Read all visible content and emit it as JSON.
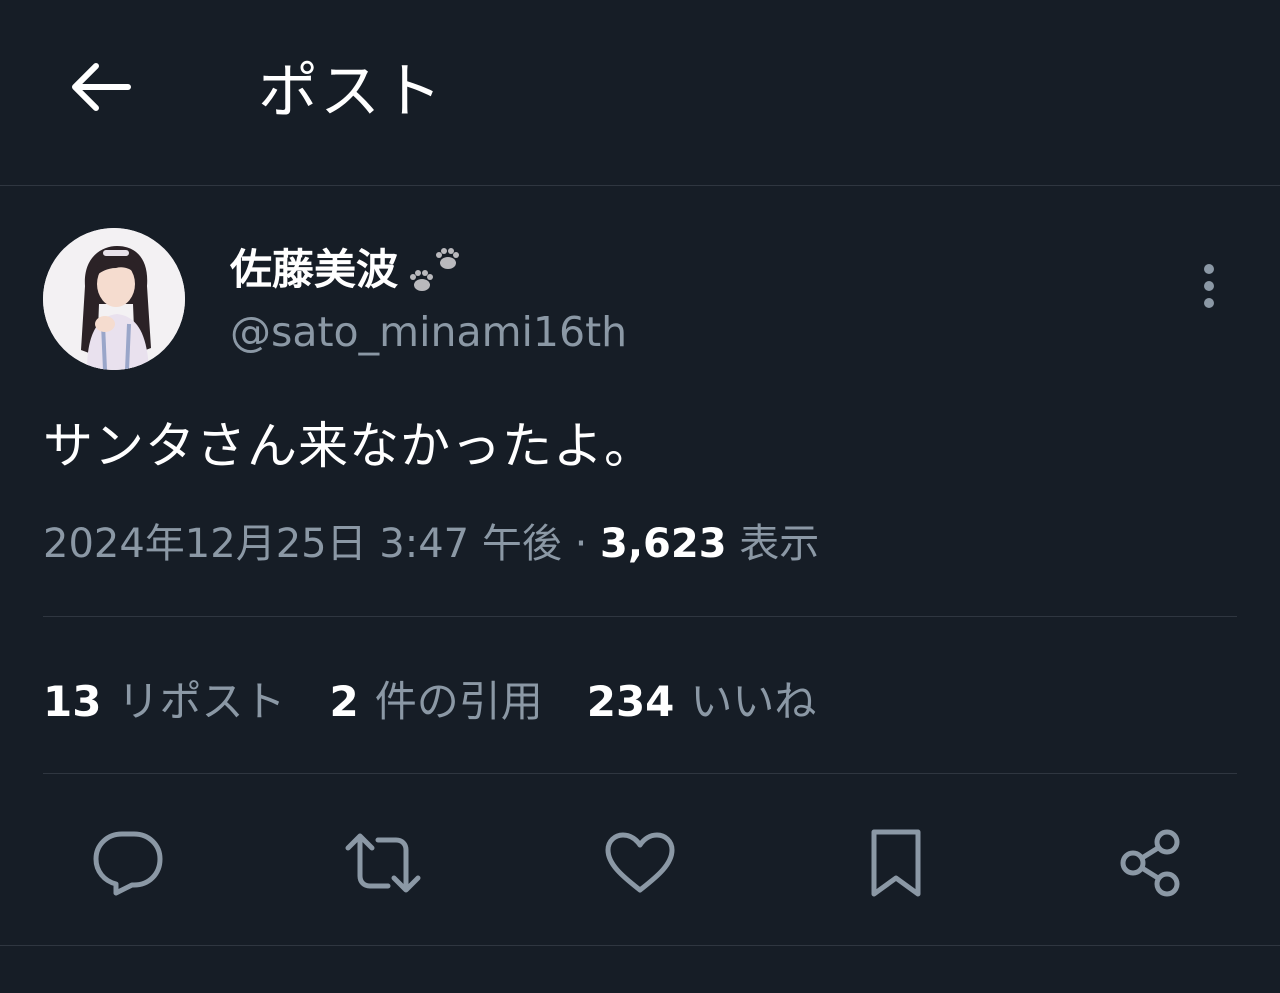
{
  "header": {
    "title": "ポスト"
  },
  "author": {
    "display_name": "佐藤美波",
    "handle": "@sato_minami16th"
  },
  "tweet": {
    "text": "サンタさん来なかったよ。",
    "timestamp": "2024年12月25日 3:47 午後",
    "separator": "·",
    "views_count": "3,623",
    "views_label": "表示"
  },
  "stats": {
    "reposts_count": "13",
    "reposts_label": "リポスト",
    "quotes_count": "2",
    "quotes_label": "件の引用",
    "likes_count": "234",
    "likes_label": "いいね"
  },
  "colors": {
    "background": "#161d26",
    "text_primary": "#ffffff",
    "text_secondary": "#8b98a5",
    "divider": "#2f3640"
  },
  "icons": {
    "back": "arrow-left-icon",
    "more": "more-vertical-icon",
    "reply": "reply-icon",
    "repost": "repost-icon",
    "like": "heart-icon",
    "bookmark": "bookmark-icon",
    "share": "share-icon",
    "name_badge": "paw-prints-icon"
  }
}
